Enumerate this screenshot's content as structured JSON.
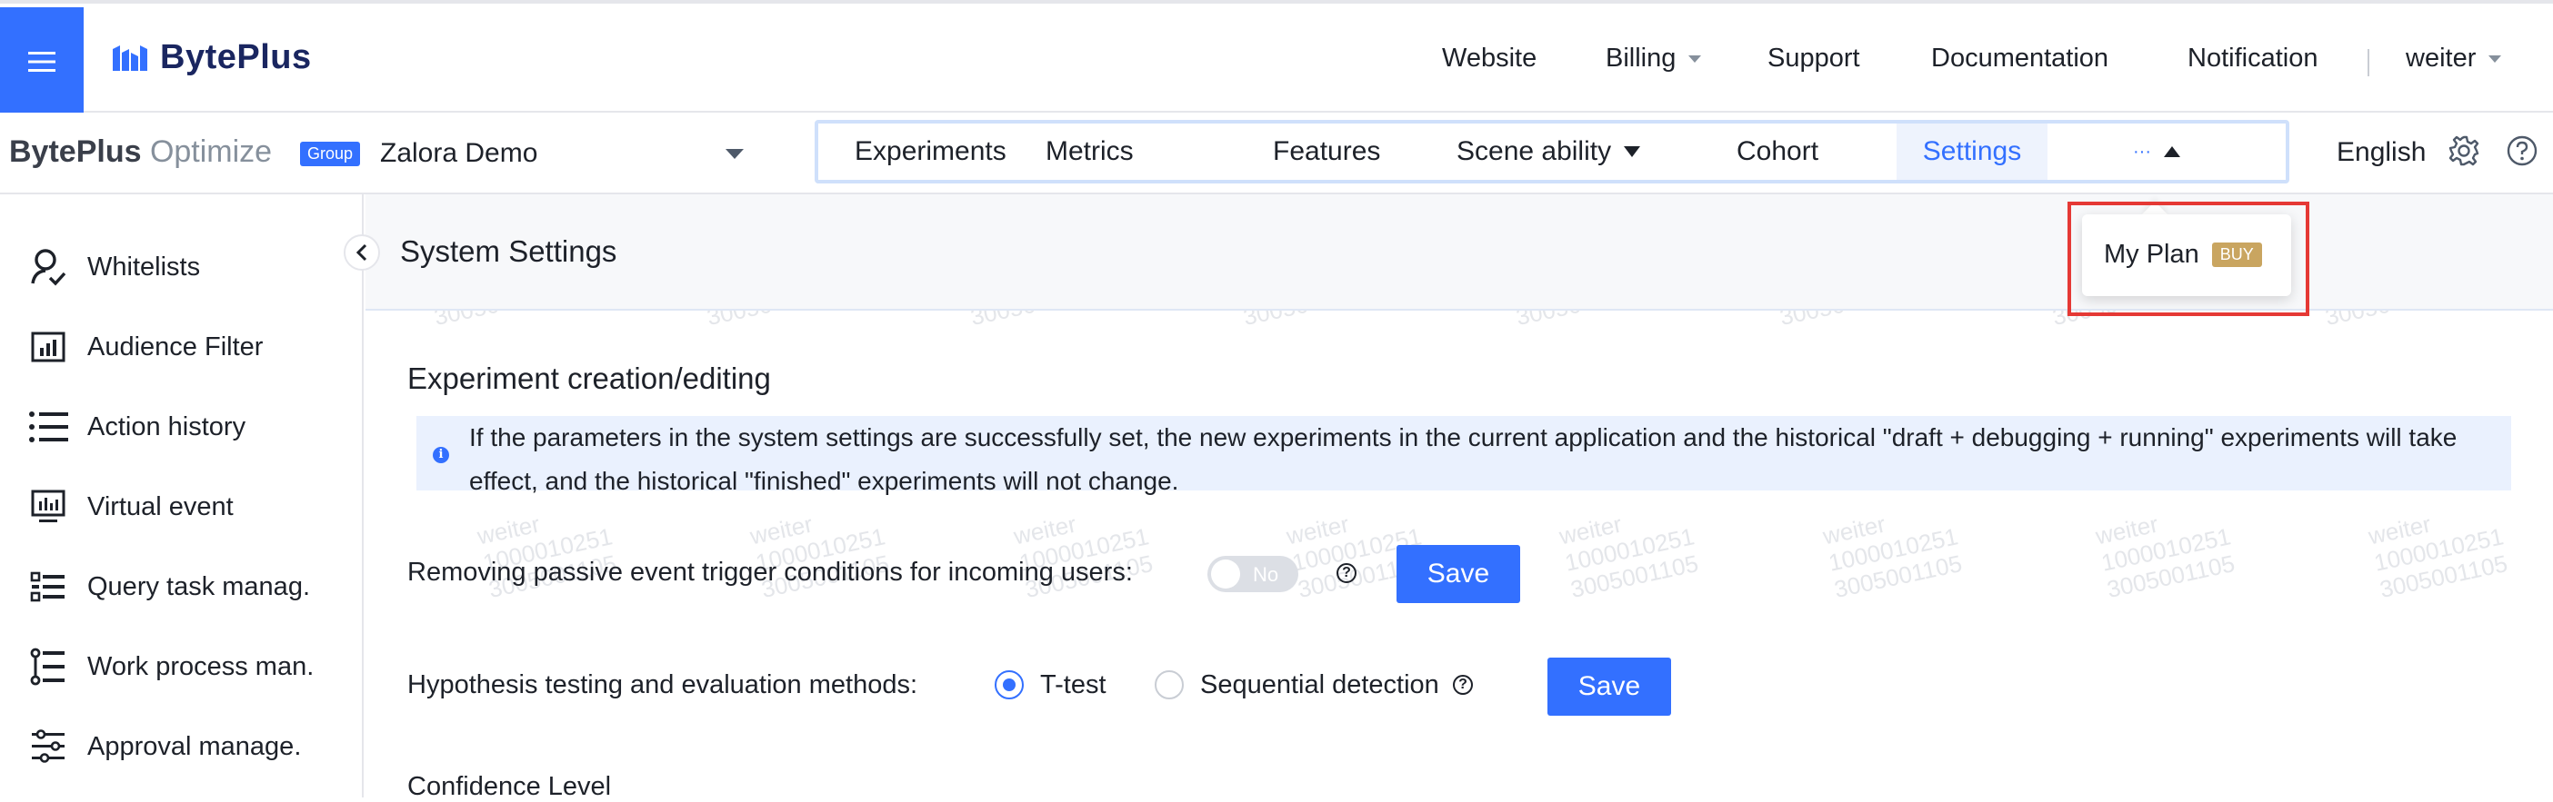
{
  "header": {
    "logo_text": "BytePlus",
    "nav": {
      "website": "Website",
      "billing": "Billing",
      "support": "Support",
      "documentation": "Documentation",
      "notification": "Notification",
      "user": "weiter"
    }
  },
  "subbar": {
    "product_bold": "BytePlus",
    "product_light": "Optimize",
    "group_badge": "Group",
    "app_name": "Zalora Demo",
    "tabs": {
      "experiments": "Experiments",
      "metrics": "Metrics",
      "features": "Features",
      "scene_ability": "Scene ability",
      "cohort": "Cohort",
      "settings": "Settings",
      "more": "···"
    },
    "language": "English"
  },
  "sidebar": {
    "items": [
      {
        "label": "Whitelists",
        "icon": "user-check-icon"
      },
      {
        "label": "Audience Filter",
        "icon": "chart-frame-icon"
      },
      {
        "label": "Action history",
        "icon": "list-icon"
      },
      {
        "label": "Virtual event",
        "icon": "monitor-chart-icon"
      },
      {
        "label": "Query task manag.",
        "icon": "task-list-icon"
      },
      {
        "label": "Work process man.",
        "icon": "process-list-icon"
      },
      {
        "label": "Approval manage.",
        "icon": "sliders-icon"
      }
    ]
  },
  "main": {
    "title": "System Settings",
    "section_title": "Experiment creation/editing",
    "info_text": "If the parameters in the system settings are successfully set, the new experiments in the current application and the historical \"draft + debugging + running\" experiments will take effect, and the historical \"finished\" experiments will not change.",
    "row1_label": "Removing passive event trigger conditions for incoming users:",
    "row1_toggle": "No",
    "row1_toggle_on": false,
    "row1_save": "Save",
    "row2_label": "Hypothesis testing and evaluation methods:",
    "row2_option1": "T-test",
    "row2_option2": "Sequential detection",
    "row2_selected": "T-test",
    "row2_save": "Save",
    "row3_label": "Confidence Level"
  },
  "popover": {
    "item": "My Plan",
    "badge": "BUY"
  },
  "watermark": {
    "name": "weiter",
    "id1": "1000010251",
    "id2": "3005001105"
  },
  "colors": {
    "primary": "#3370ff",
    "badge_gold": "#c9a560",
    "highlight_red": "#e53935"
  }
}
